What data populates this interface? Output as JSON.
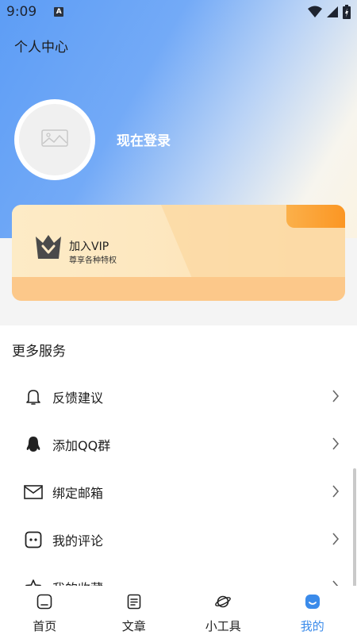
{
  "status_bar": {
    "time": "9:09",
    "notification_badge": "A",
    "icons": [
      "wifi-icon",
      "signal-icon",
      "battery-charging-icon"
    ]
  },
  "page": {
    "title": "个人中心"
  },
  "profile": {
    "avatar_icon": "image-placeholder-icon",
    "login_label": "现在登录"
  },
  "vip_card": {
    "icon": "crown-icon",
    "title": "加入VIP",
    "subtitle": "尊享各种特权",
    "colors": {
      "accent": "#fb9623",
      "base": "#fcc88a"
    }
  },
  "services": {
    "section_title": "更多服务",
    "items": [
      {
        "label": "反馈建议",
        "icon": "bell-icon"
      },
      {
        "label": "添加QQ群",
        "icon": "qq-penguin-icon"
      },
      {
        "label": "绑定邮箱",
        "icon": "mail-icon"
      },
      {
        "label": "我的评论",
        "icon": "comment-icon"
      },
      {
        "label": "我的收藏",
        "icon": "star-icon"
      }
    ]
  },
  "bottom_nav": {
    "active_index": 3,
    "active_color": "#3b8bea",
    "items": [
      {
        "label": "首页",
        "icon": "home-icon"
      },
      {
        "label": "文章",
        "icon": "article-icon"
      },
      {
        "label": "小工具",
        "icon": "planet-icon"
      },
      {
        "label": "我的",
        "icon": "profile-icon"
      }
    ]
  }
}
